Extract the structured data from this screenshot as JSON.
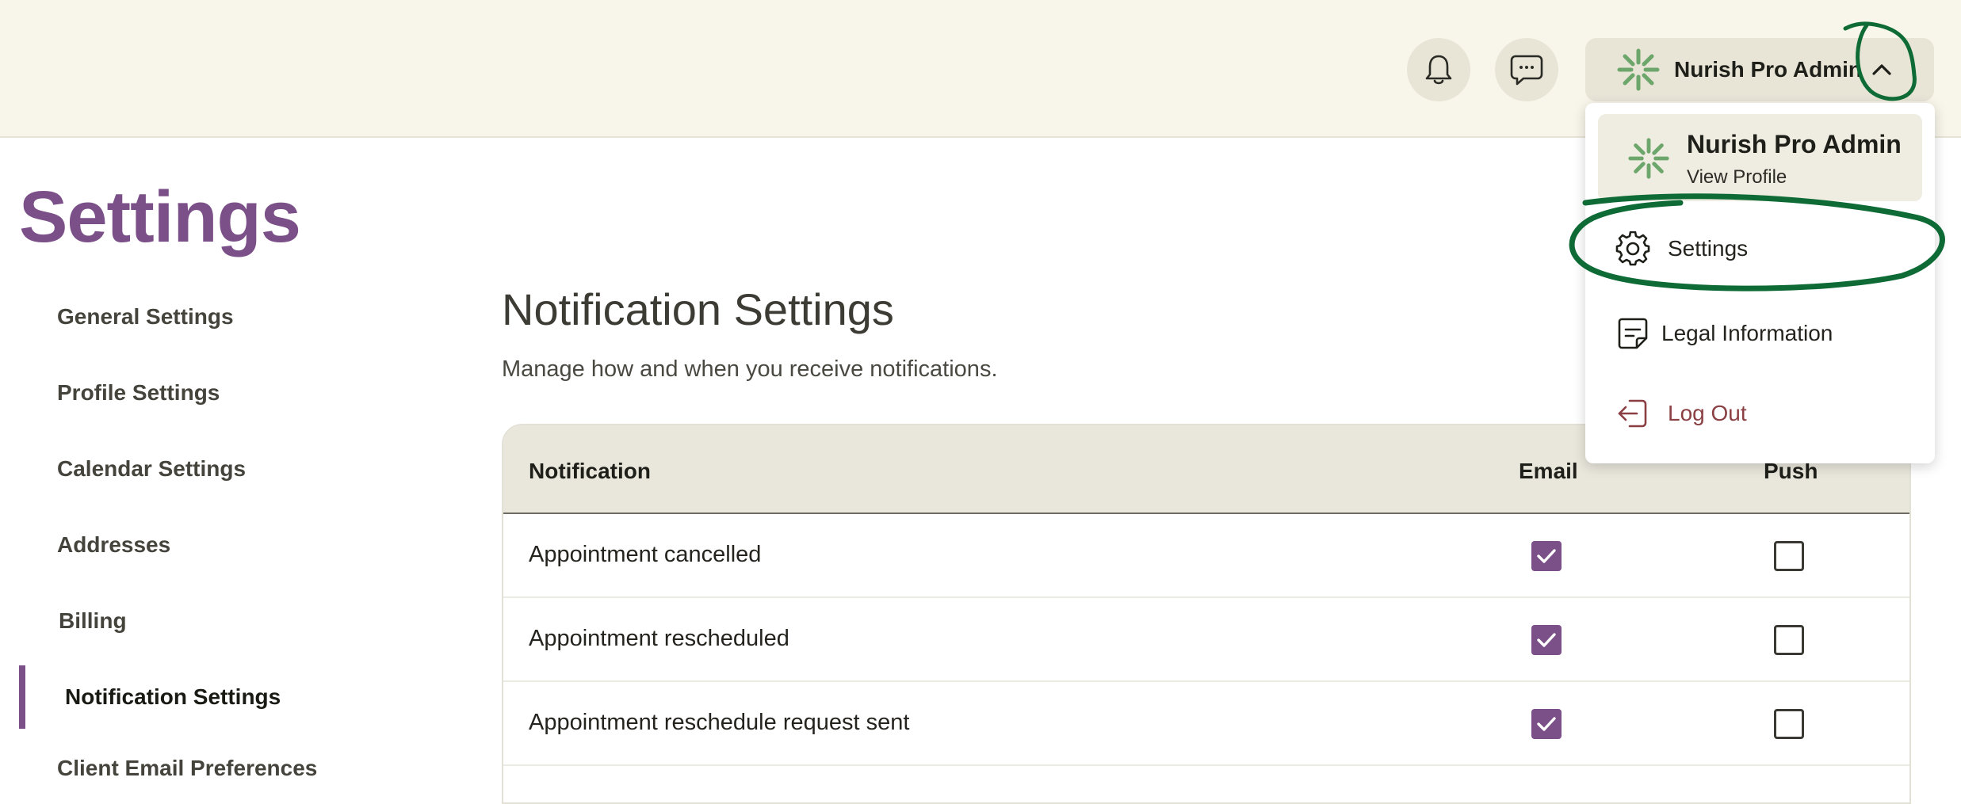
{
  "header": {
    "notifications_icon": "bell-icon",
    "messages_icon": "chat-bubble-icon",
    "user_name": "Nurish Pro Admin",
    "user_menu_icon": "chevron-up-icon"
  },
  "page": {
    "title": "Settings"
  },
  "sidebar": {
    "items": [
      {
        "label": "General Settings"
      },
      {
        "label": "Profile Settings"
      },
      {
        "label": "Calendar Settings"
      },
      {
        "label": "Addresses"
      },
      {
        "label": "Billing"
      },
      {
        "label": "Notification Settings",
        "active": true
      },
      {
        "label": "Client Email Preferences"
      }
    ]
  },
  "main": {
    "title": "Notification Settings",
    "subtitle": "Manage how and when you receive notifications.",
    "table": {
      "columns": [
        "Notification",
        "Email",
        "Push"
      ],
      "rows": [
        {
          "label": "Appointment cancelled",
          "email": true,
          "push": false
        },
        {
          "label": "Appointment rescheduled",
          "email": true,
          "push": false
        },
        {
          "label": "Appointment reschedule request sent",
          "email": true,
          "push": false
        }
      ]
    }
  },
  "dropdown": {
    "profile": {
      "name": "Nurish Pro Admin",
      "link": "View Profile"
    },
    "items": [
      {
        "label": "Settings",
        "icon": "gear-icon"
      },
      {
        "label": "Legal Information",
        "icon": "document-icon"
      },
      {
        "label": "Log Out",
        "icon": "logout-icon"
      }
    ]
  },
  "colors": {
    "brand_purple": "#7b4f87",
    "header_bg": "#f8f6ea",
    "annotation_green": "#0f6b35",
    "logout_red": "#8a3f43",
    "logo_green": "#6ca66a"
  }
}
